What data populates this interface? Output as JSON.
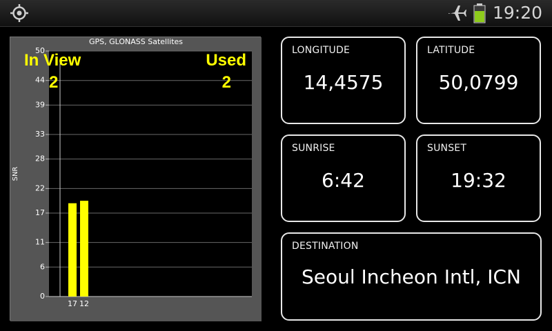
{
  "status_bar": {
    "left_icon": "gps-target-icon",
    "airplane_icon": "airplane-icon",
    "battery_icon": "battery-icon",
    "battery_color": "#8ecb1c",
    "time": "19:20"
  },
  "satellites": {
    "in_view_label": "In View",
    "in_view_count": "2",
    "used_label": "Used",
    "used_count": "2"
  },
  "chart_data": {
    "type": "bar",
    "title": "GPS, GLONASS Satellites",
    "ylabel": "SNR",
    "xlabel": "",
    "ylim": [
      0,
      50
    ],
    "yticks": [
      0,
      6,
      11,
      17,
      22,
      28,
      33,
      39,
      44,
      50
    ],
    "categories": [
      "17",
      "12"
    ],
    "values": [
      19,
      19.5
    ],
    "bar_color": "#ffff00",
    "grid": true
  },
  "cards": {
    "longitude": {
      "label": "LONGITUDE",
      "value": "14,4575"
    },
    "latitude": {
      "label": "LATITUDE",
      "value": "50,0799"
    },
    "sunrise": {
      "label": "SUNRISE",
      "value": "6:42"
    },
    "sunset": {
      "label": "SUNSET",
      "value": "19:32"
    },
    "destination": {
      "label": "DESTINATION",
      "value": "Seoul Incheon Intl, ICN"
    }
  }
}
